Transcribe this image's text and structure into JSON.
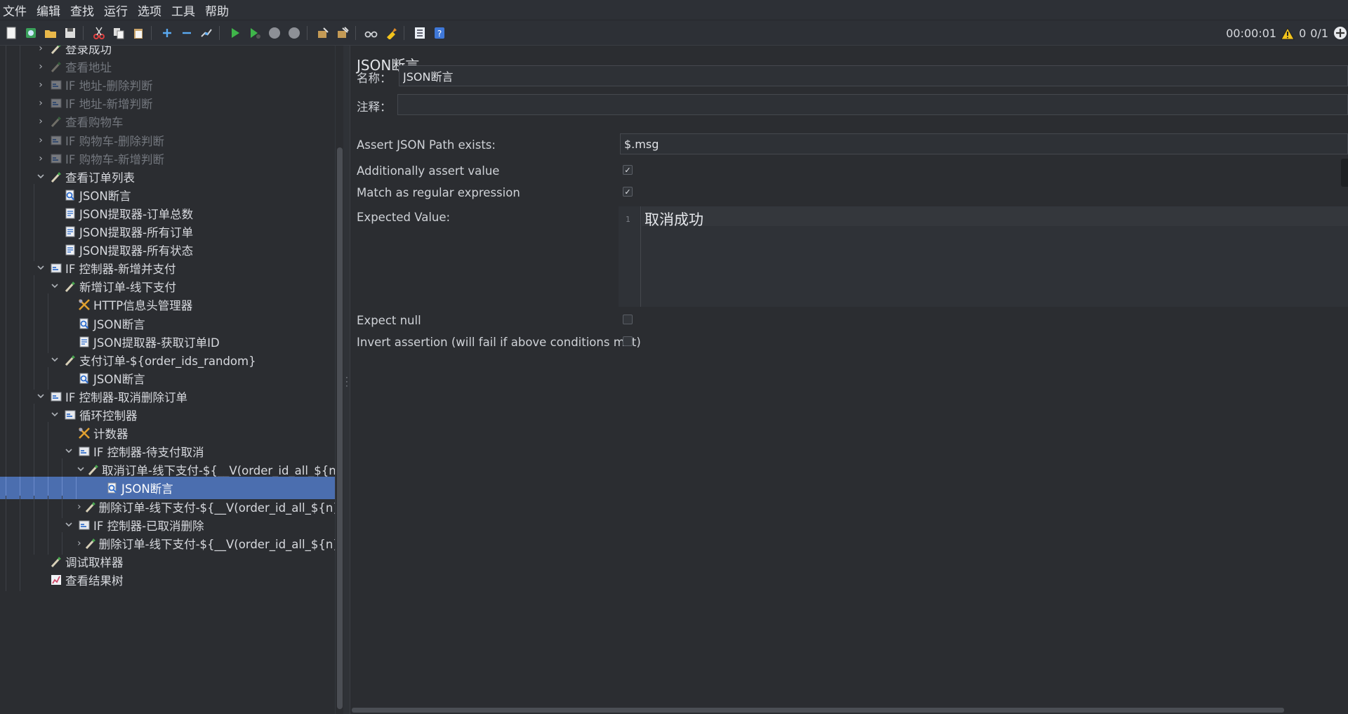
{
  "menu": [
    "文件",
    "编辑",
    "查找",
    "运行",
    "选项",
    "工具",
    "帮助"
  ],
  "toolbar": {
    "timer": "00:00:01",
    "warnings": "0",
    "threads": "0/1"
  },
  "tree": [
    {
      "label": "登录成功",
      "depth": 2,
      "toggle": "right",
      "icon": "sampler",
      "disabled": false
    },
    {
      "label": "查看地址",
      "depth": 2,
      "toggle": "right",
      "icon": "sampler",
      "disabled": true
    },
    {
      "label": "IF 地址-删除判断",
      "depth": 2,
      "toggle": "right",
      "icon": "controller",
      "disabled": true
    },
    {
      "label": "IF 地址-新增判断",
      "depth": 2,
      "toggle": "right",
      "icon": "controller",
      "disabled": true
    },
    {
      "label": "查看购物车",
      "depth": 2,
      "toggle": "right",
      "icon": "sampler",
      "disabled": true
    },
    {
      "label": "IF 购物车-删除判断",
      "depth": 2,
      "toggle": "right",
      "icon": "controller",
      "disabled": true
    },
    {
      "label": "IF 购物车-新增判断",
      "depth": 2,
      "toggle": "right",
      "icon": "controller",
      "disabled": true
    },
    {
      "label": "查看订单列表",
      "depth": 2,
      "toggle": "down",
      "icon": "sampler",
      "disabled": false
    },
    {
      "label": "JSON断言",
      "depth": 3,
      "toggle": "",
      "icon": "assertion",
      "disabled": false
    },
    {
      "label": "JSON提取器-订单总数",
      "depth": 3,
      "toggle": "",
      "icon": "extractor",
      "disabled": false
    },
    {
      "label": "JSON提取器-所有订单",
      "depth": 3,
      "toggle": "",
      "icon": "extractor",
      "disabled": false
    },
    {
      "label": "JSON提取器-所有状态",
      "depth": 3,
      "toggle": "",
      "icon": "extractor",
      "disabled": false
    },
    {
      "label": "IF 控制器-新增并支付",
      "depth": 2,
      "toggle": "down",
      "icon": "controller",
      "disabled": false
    },
    {
      "label": "新增订单-线下支付",
      "depth": 3,
      "toggle": "down",
      "icon": "sampler",
      "disabled": false
    },
    {
      "label": "HTTP信息头管理器",
      "depth": 4,
      "toggle": "",
      "icon": "config",
      "disabled": false
    },
    {
      "label": "JSON断言",
      "depth": 4,
      "toggle": "",
      "icon": "assertion",
      "disabled": false
    },
    {
      "label": "JSON提取器-获取订单ID",
      "depth": 4,
      "toggle": "",
      "icon": "extractor",
      "disabled": false
    },
    {
      "label": "支付订单-${order_ids_random}",
      "depth": 3,
      "toggle": "down",
      "icon": "sampler",
      "disabled": false
    },
    {
      "label": "JSON断言",
      "depth": 4,
      "toggle": "",
      "icon": "assertion",
      "disabled": false
    },
    {
      "label": "IF 控制器-取消删除订单",
      "depth": 2,
      "toggle": "down",
      "icon": "controller",
      "disabled": false
    },
    {
      "label": "循环控制器",
      "depth": 3,
      "toggle": "down",
      "icon": "controller",
      "disabled": false
    },
    {
      "label": "计数器",
      "depth": 4,
      "toggle": "",
      "icon": "config",
      "disabled": false
    },
    {
      "label": "IF 控制器-待支付取消",
      "depth": 4,
      "toggle": "down",
      "icon": "controller",
      "disabled": false
    },
    {
      "label": "取消订单-线下支付-${__V(order_id_all_${n})}",
      "depth": 5,
      "toggle": "down",
      "icon": "sampler",
      "disabled": false
    },
    {
      "label": "JSON断言",
      "depth": 6,
      "toggle": "",
      "icon": "assertion",
      "disabled": false,
      "selected": true
    },
    {
      "label": "删除订单-线下支付-${__V(order_id_all_${n})}",
      "depth": 5,
      "toggle": "right",
      "icon": "sampler",
      "disabled": false
    },
    {
      "label": "IF 控制器-已取消删除",
      "depth": 4,
      "toggle": "down",
      "icon": "controller",
      "disabled": false
    },
    {
      "label": "删除订单-线下支付-${__V(order_id_all_${n})}",
      "depth": 5,
      "toggle": "right",
      "icon": "sampler",
      "disabled": false
    },
    {
      "label": "调试取样器",
      "depth": 2,
      "toggle": "",
      "icon": "sampler",
      "disabled": false
    },
    {
      "label": "查看结果树",
      "depth": 2,
      "toggle": "",
      "icon": "listener",
      "disabled": false
    }
  ],
  "panel": {
    "title": "JSON断言",
    "name_label": "名称：",
    "name_value": "JSON断言",
    "comment_label": "注释：",
    "comment_value": "",
    "path_label": "Assert JSON Path exists:",
    "path_value": "$.msg",
    "assert_value_label": "Additionally assert value",
    "assert_value_checked": true,
    "regex_label": "Match as regular expression",
    "regex_checked": true,
    "expected_label": "Expected Value:",
    "expected_line_no": "1",
    "expected_value": "取消成功",
    "expect_null_label": "Expect null",
    "expect_null_checked": false,
    "invert_label": "Invert assertion (will fail if above conditions met)",
    "invert_checked": false
  },
  "colors": {
    "background": "#2b2d31",
    "selection": "#4b6eaf",
    "run_green": "#3fb54a",
    "warning_yellow": "#f2c31c"
  }
}
